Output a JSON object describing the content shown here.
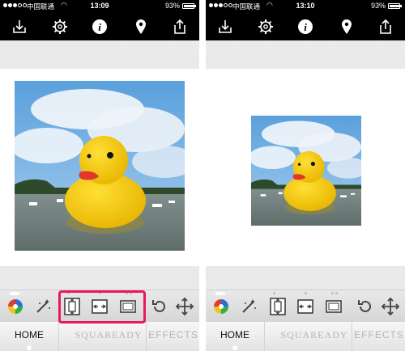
{
  "status_bar": {
    "carrier": "中国联通",
    "battery_pct": "93%",
    "battery_level": 0.93
  },
  "screens": [
    {
      "time": "13:09"
    },
    {
      "time": "13:10"
    }
  ],
  "toolbar": {
    "icons": [
      "download-icon",
      "gear-icon",
      "info-icon",
      "map-pin-icon",
      "share-icon"
    ]
  },
  "tools": {
    "icons": [
      "color-wheel-icon",
      "magic-wand-icon",
      "fit-vertical-icon",
      "fit-horizontal-icon",
      "frame-icon",
      "rotate-icon",
      "move-icon"
    ]
  },
  "tabs": {
    "home": "HOME",
    "squaready": "SQUAREADY",
    "effects": "EFFECTS"
  },
  "colors": {
    "highlight": "#e8195b",
    "toolbar": "#000000"
  }
}
